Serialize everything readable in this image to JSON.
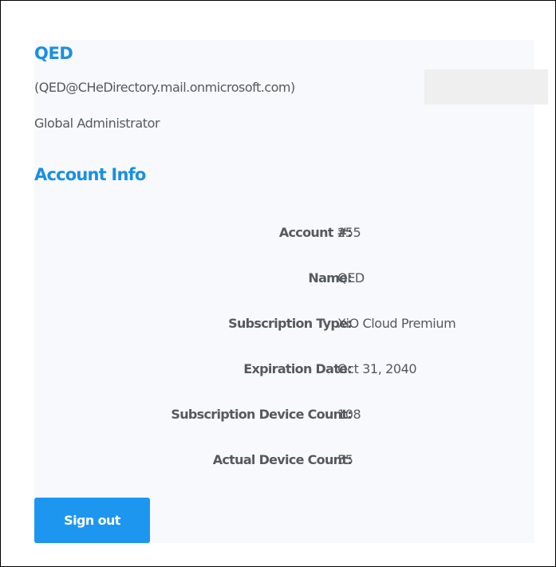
{
  "user": {
    "name": "QED",
    "email": "(QED@CHeDirectory.mail.onmicrosoft.com)",
    "role": "Global Administrator"
  },
  "account_info": {
    "title": "Account Info",
    "rows": [
      {
        "label": "Account #:",
        "value": "255"
      },
      {
        "label": "Name:",
        "value": "QED"
      },
      {
        "label": "Subscription Type:",
        "value": "XiO Cloud Premium"
      },
      {
        "label": "Expiration Date:",
        "value": "Oct 31, 2040"
      },
      {
        "label": "Subscription Device Count:",
        "value": "108"
      },
      {
        "label": "Actual Device Count:",
        "value": "55"
      }
    ]
  },
  "actions": {
    "sign_out_label": "Sign out"
  },
  "colors": {
    "accent": "#1a8fe3",
    "button": "#1d96f0",
    "text": "#555a60",
    "panel": "#f7f9fc"
  }
}
